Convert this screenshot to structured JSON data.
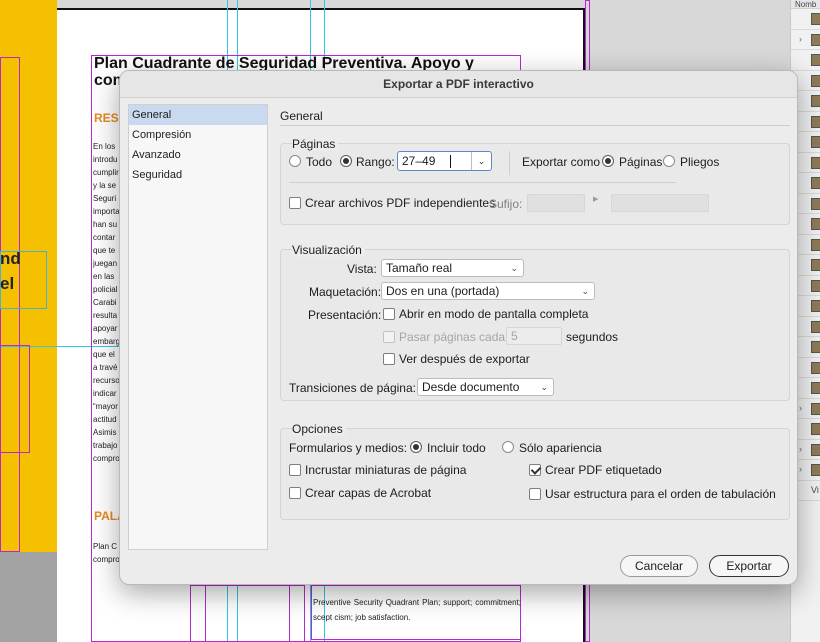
{
  "window": {
    "title": "Exportar a PDF interactivo"
  },
  "document": {
    "title": "Plan Cuadrante de Seguridad Preventiva. Apoyo y com",
    "heading_resumen": "RES",
    "heading_palabras": "PALA",
    "column_lines": [
      "En los",
      "introdu",
      "cumplir",
      "y la se",
      "Seguri",
      "importa",
      "han su",
      "contar",
      "que te",
      "juegan",
      "en las",
      "policial",
      "Carabi",
      "resulta",
      "apoyar",
      "embarg",
      "que el",
      "a travé",
      "recurso",
      "indicar",
      "“mayor",
      "actitud",
      "Asimis",
      "trabajo",
      "compro"
    ],
    "column2_lines": [
      "Plan C",
      "compro"
    ],
    "keywords_en": "Preventive Security Quadrant Plan; support; commitment; scept cism; job satisfaction.",
    "left_text_1": "nd",
    "left_text_2": "el"
  },
  "panel": {
    "header": "Nomb",
    "bottom_label": "Vi"
  },
  "nav": {
    "items": [
      {
        "label": "General",
        "selected": true
      },
      {
        "label": "Compresión",
        "selected": false
      },
      {
        "label": "Avanzado",
        "selected": false
      },
      {
        "label": "Seguridad",
        "selected": false
      }
    ]
  },
  "general": {
    "title": "General"
  },
  "paginas": {
    "label": "Páginas",
    "todo_label": "Todo",
    "rango_label": "Rango:",
    "rango_value": "27–49",
    "exportar_como_label": "Exportar como",
    "paginas_label": "Páginas",
    "pliegos_label": "Pliegos",
    "crear_independientes_label": "Crear archivos PDF independientes",
    "sufijo_label": "Sufijo:"
  },
  "visualizacion": {
    "label": "Visualización",
    "vista_label": "Vista:",
    "vista_value": "Tamaño real",
    "maquetacion_label": "Maquetación:",
    "maquetacion_value": "Dos en una (portada)",
    "presentacion_label": "Presentación:",
    "pantalla_completa_label": "Abrir en modo de pantalla completa",
    "pasar_paginas_label": "Pasar páginas cada:",
    "pasar_paginas_value": "5",
    "segundos_label": "segundos",
    "ver_despues_label": "Ver después de exportar",
    "transiciones_label": "Transiciones de página:",
    "transiciones_value": "Desde documento"
  },
  "opciones": {
    "label": "Opciones",
    "formularios_label": "Formularios y medios:",
    "incluir_todo_label": "Incluir todo",
    "solo_apariencia_label": "Sólo apariencia",
    "incrustar_miniaturas_label": "Incrustar miniaturas de página",
    "crear_etiquetado_label": "Crear PDF etiquetado",
    "crear_capas_label": "Crear capas de Acrobat",
    "usar_estructura_label": "Usar estructura para el orden de tabulación"
  },
  "buttons": {
    "cancel_label": "Cancelar",
    "export_label": "Exportar"
  },
  "colors": {
    "accent_yellow": "#f4c000",
    "guide_cyan": "#31c6e3",
    "frame_magenta": "#b52ad0",
    "selection_blue": "#c9d9ef"
  }
}
